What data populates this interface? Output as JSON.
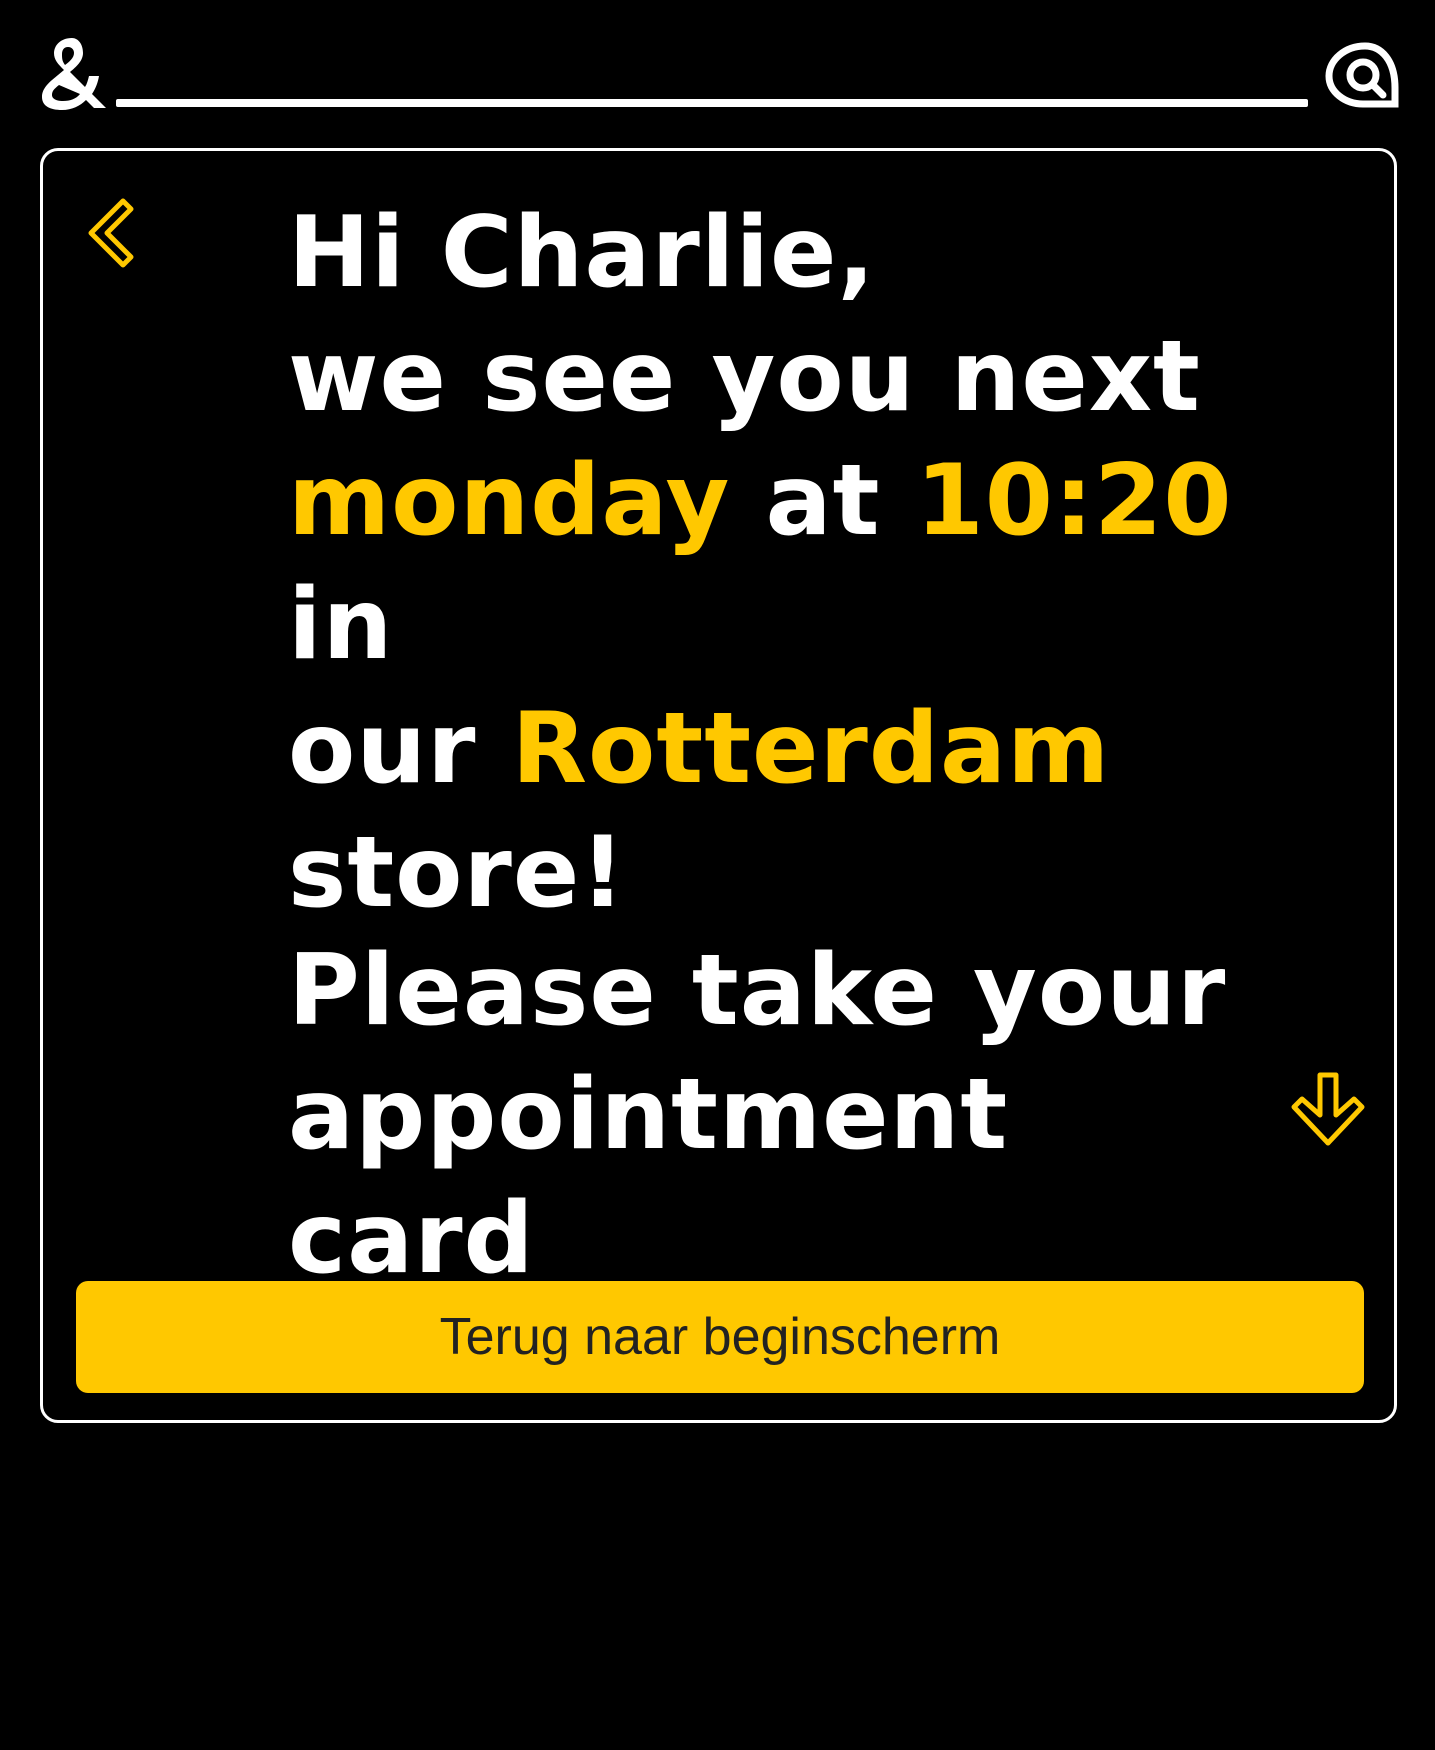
{
  "header": {
    "brand_icon": "ampersand-logo",
    "right_icon": "at-sign-icon"
  },
  "card": {
    "back_icon": "chevron-left-icon",
    "message": {
      "greeting": "Hi Charlie,",
      "line2": "we see you next",
      "day": "monday",
      "at": "at",
      "time": "10:20",
      "in": "in",
      "our": "our",
      "store_name": "Rotterdam",
      "store_suffix": "store!"
    },
    "instruction": {
      "line1": "Please take your",
      "line2": "appointment card"
    },
    "down_icon": "arrow-down-icon",
    "home_button_label": "Terug naar beginscherm"
  },
  "colors": {
    "background": "#000000",
    "accent": "#ffc800",
    "text": "#ffffff",
    "button_text": "#222222"
  }
}
